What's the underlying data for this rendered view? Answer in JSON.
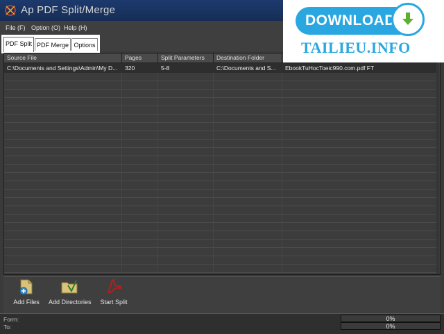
{
  "window": {
    "title": "Ap PDF Split/Merge"
  },
  "menu": [
    {
      "label": "File (F)"
    },
    {
      "label": "Option (O)"
    },
    {
      "label": "Help (H)"
    }
  ],
  "tabs": [
    {
      "label": "PDF Split",
      "active": true
    },
    {
      "label": "PDF Merge",
      "active": false
    },
    {
      "label": "Options",
      "active": false
    }
  ],
  "table": {
    "columns": [
      "Source File",
      "Pages",
      "Split Parameters",
      "Destination Folder",
      ""
    ],
    "rows": [
      [
        "C:\\Documents and Settings\\Admin\\My D...",
        "320",
        "5-8",
        "C:\\Documents and S...",
        "EbookTuHocToeic990.com.pdf FT"
      ]
    ]
  },
  "toolbar": {
    "add_files": "Add Files",
    "add_directories": "Add Directories",
    "start_split": "Start Split"
  },
  "status": {
    "form_label": "Form:",
    "to_label": "To:",
    "progress1": {
      "text": "0%",
      "value": 0
    },
    "progress2": {
      "text": "0%",
      "value": 0
    }
  },
  "watermark": {
    "download_text": "DOWNLOAD",
    "site_text": "TAILIEU.INFO"
  },
  "colors": {
    "titlebar": "#1d3a6e",
    "watermark_blue": "#2aa7e0",
    "arrow_green": "#5bb030"
  }
}
